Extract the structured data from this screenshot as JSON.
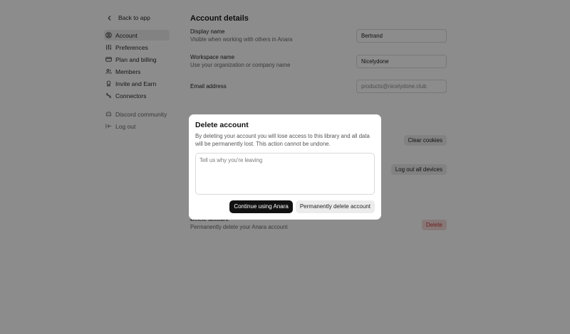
{
  "sidebar": {
    "back_label": "Back to app",
    "items": [
      {
        "label": "Account",
        "icon": "user-circle-icon"
      },
      {
        "label": "Preferences",
        "icon": "sliders-icon"
      },
      {
        "label": "Plan and billing",
        "icon": "credit-card-icon"
      },
      {
        "label": "Members",
        "icon": "users-icon"
      },
      {
        "label": "Invite and Earn",
        "icon": "award-icon"
      },
      {
        "label": "Connectors",
        "icon": "connectors-icon"
      }
    ],
    "secondary": [
      {
        "label": "Discord community",
        "icon": "discord-icon"
      },
      {
        "label": "Log out",
        "icon": "logout-icon"
      }
    ]
  },
  "main": {
    "title": "Account details",
    "display_name": {
      "title": "Display name",
      "desc": "Visible when working with others in Anara",
      "value": "Bertrand"
    },
    "workspace_name": {
      "title": "Workspace name",
      "desc": "Use your organization or company name",
      "value": "Nicelydone"
    },
    "email": {
      "title": "Email address",
      "placeholder": "products@nicelydone.club"
    },
    "clear_cookies_label": "Clear cookies",
    "logout_all_label": "Log out all devices",
    "delete_row": {
      "title": "Delete account",
      "desc": "Permanently delete your Anara account",
      "button": "Delete"
    }
  },
  "modal": {
    "title": "Delete account",
    "body": "By deleting your account you will lose access to this library and all data will be permanently lost. This action cannot be undone.",
    "textarea_placeholder": "Tell us why you're leaving",
    "continue_label": "Continue using Anara",
    "delete_label": "Permanently delete account"
  },
  "colors": {
    "overlay": "#000000",
    "primary_button": "#111111",
    "danger": "#c83a3a"
  }
}
